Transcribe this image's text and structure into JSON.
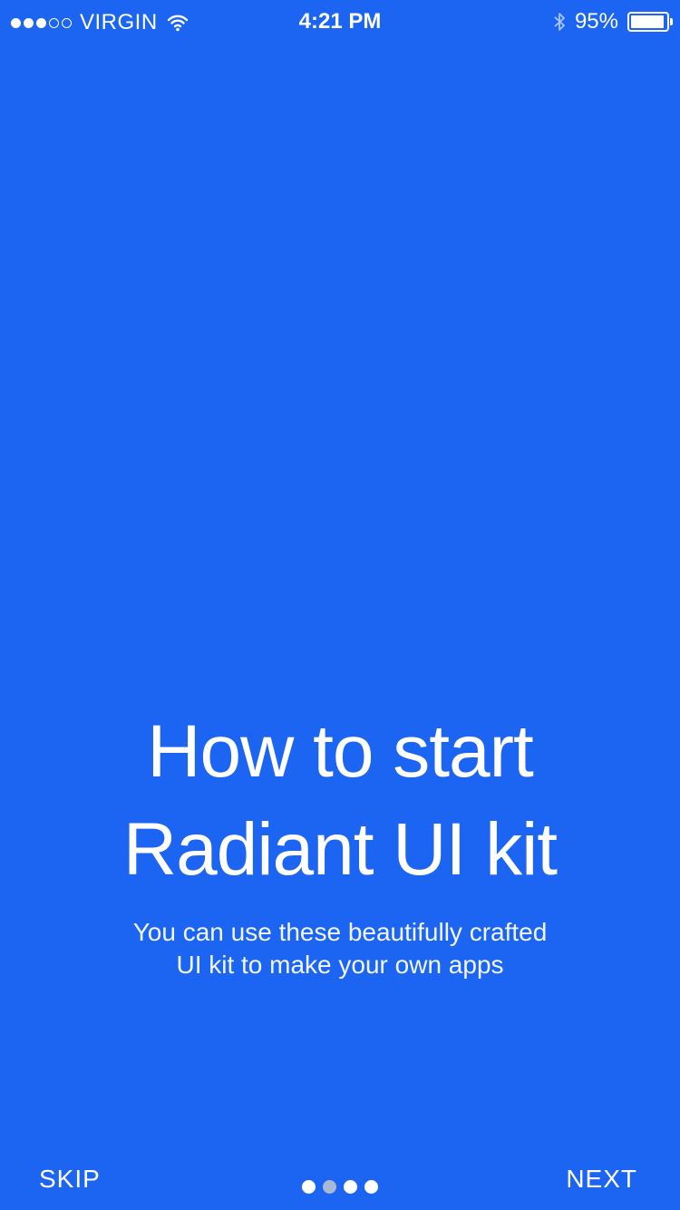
{
  "status_bar": {
    "signal_filled": 3,
    "signal_total": 5,
    "carrier": "VIRGIN",
    "wifi_icon": "wifi-icon",
    "time": "4:21 PM",
    "bluetooth_icon": "bluetooth-icon",
    "battery_percent": "95%",
    "battery_level": 0.95
  },
  "onboarding": {
    "title_line1": "How to start",
    "title_line2": "Radiant UI kit",
    "subtitle_line1": "You can use these beautifully crafted",
    "subtitle_line2": "UI kit to make your own apps"
  },
  "footer": {
    "skip_label": "SKIP",
    "next_label": "NEXT",
    "page_count": 4,
    "current_page": 2
  },
  "colors": {
    "background": "#1c64f2",
    "text": "#ffffff",
    "page_dot_active": "#a9b8d6",
    "page_dot_inactive": "#ffffff"
  }
}
